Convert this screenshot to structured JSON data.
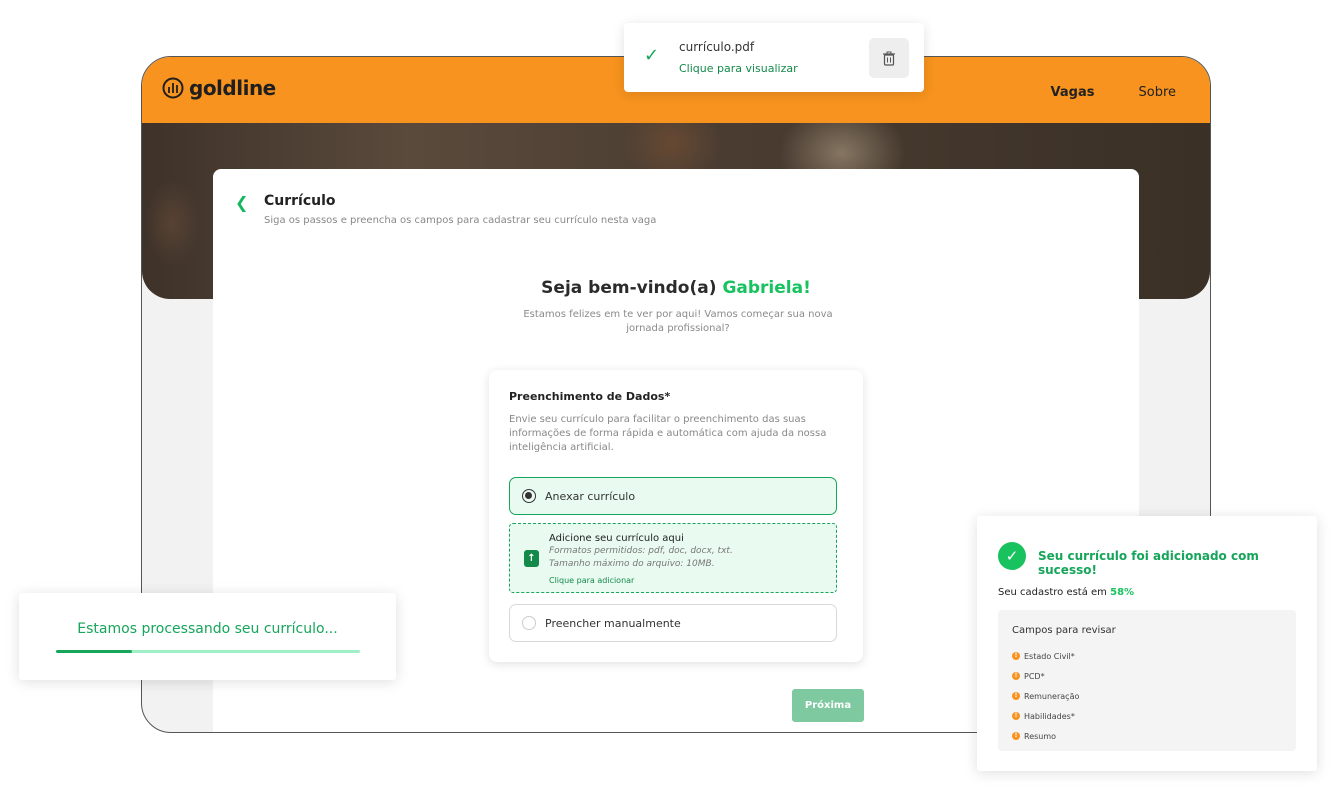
{
  "brand": {
    "name": "goldline"
  },
  "nav": {
    "items": [
      "Vagas",
      "Sobre"
    ],
    "active": "Vagas"
  },
  "page": {
    "title": "Currículo",
    "subtitle": "Siga os passos e preencha os campos para cadastrar seu currículo nesta vaga"
  },
  "welcome": {
    "prefix": "Seja bem-vindo(a)",
    "name": "Gabriela!",
    "description": "Estamos felizes em te ver por aqui! Vamos começar sua nova jornada profissional?"
  },
  "form": {
    "title": "Preenchimento de Dados*",
    "description": "Envie seu currículo para facilitar o preenchimento das suas informações de forma rápida e automática com ajuda da nossa inteligência artificial.",
    "option_attach": "Anexar currículo",
    "option_manual": "Preencher manualmente",
    "upload": {
      "title": "Adicione seu currículo aqui",
      "formats": "Formatos permitidos: pdf, doc, docx, txt.",
      "max_size": "Tamanho máximo do arquivo: 10MB.",
      "link": "Clique para adicionar"
    },
    "next_label": "Próxima"
  },
  "file_toast": {
    "filename": "currículo.pdf",
    "link": "Clique para visualizar"
  },
  "processing": {
    "text": "Estamos processando seu currículo...",
    "progress": 0.25
  },
  "success": {
    "title": "Seu currículo foi adicionado com sucesso!",
    "status_prefix": "Seu cadastro está em",
    "status_pct": "58%",
    "review_title": "Campos para revisar",
    "review_items": [
      "Estado Civil*",
      "PCD*",
      "Remuneração",
      "Habilidades*",
      "Resumo"
    ]
  },
  "colors": {
    "brand_orange": "#f7931e",
    "accent_green": "#18c25f",
    "dark_green": "#138a4a"
  },
  "icons": {
    "logo": "goldline-logo-icon",
    "back": "chevron-left-icon",
    "check": "check-icon",
    "trash": "trash-icon",
    "upload": "upload-file-icon",
    "warning": "warning-dot-icon"
  }
}
